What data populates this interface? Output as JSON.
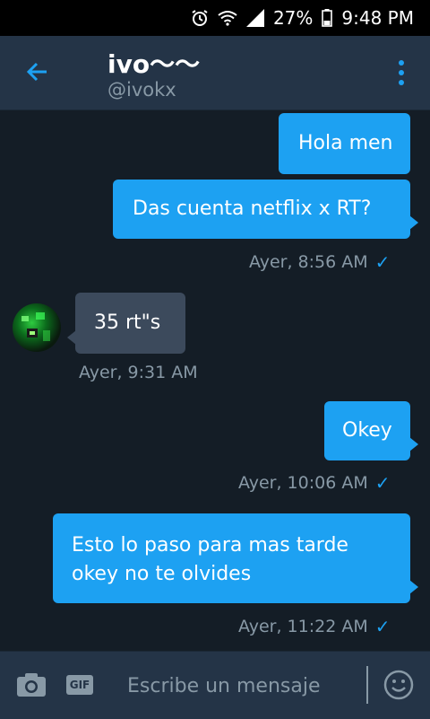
{
  "status_bar": {
    "battery": "27%",
    "time": "9:48 PM"
  },
  "header": {
    "name": "ivo〜〜",
    "handle": "@ivokx"
  },
  "messages": [
    {
      "text": "Hola men",
      "direction": "sent"
    },
    {
      "text": "Das cuenta netflix x RT?",
      "direction": "sent",
      "time": "Ayer, 8:56 AM"
    },
    {
      "text": "35 rt\"s",
      "direction": "received",
      "time": "Ayer, 9:31 AM"
    },
    {
      "text": "Okey",
      "direction": "sent",
      "time": "Ayer, 10:06 AM"
    },
    {
      "text": "Esto lo paso para mas tarde okey no te olvides",
      "direction": "sent",
      "time": "Ayer, 11:22 AM"
    }
  ],
  "composer": {
    "gif_label": "GIF",
    "placeholder": "Escribe un mensaje"
  },
  "icons": {
    "status": [
      "alarm-icon",
      "wifi-icon",
      "signal-icon",
      "battery-icon"
    ],
    "header": [
      "back-arrow-icon",
      "more-vertical-icon"
    ],
    "composer": [
      "camera-icon",
      "gif-icon",
      "emoji-icon"
    ],
    "read_receipt": "check-icon"
  },
  "colors": {
    "background": "#141d26",
    "header": "#243447",
    "sent_bubble": "#1da1f2",
    "received_bubble": "#3c4a5c",
    "meta_text": "#8899a6",
    "accent": "#1da1f2"
  }
}
